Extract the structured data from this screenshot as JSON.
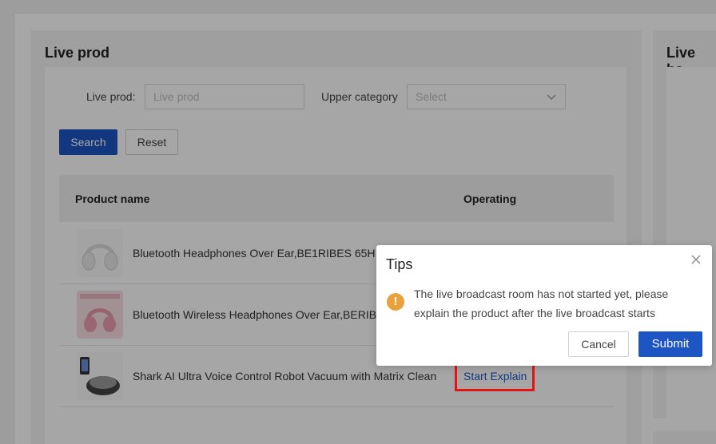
{
  "left_panel": {
    "title": "Live prod"
  },
  "right_panel": {
    "title": "Live ba"
  },
  "filters": {
    "live_prod_label": "Live prod:",
    "live_prod_placeholder": "Live prod",
    "upper_category_label": "Upper category",
    "upper_category_placeholder": "Select"
  },
  "buttons": {
    "search": "Search",
    "reset": "Reset"
  },
  "table": {
    "headers": {
      "product_name": "Product name",
      "operating": "Operating"
    },
    "rows": [
      {
        "name": "Bluetooth Headphones Over Ear,BE1RIBES 65H",
        "thumb_icon": "headphones-white-image",
        "action": ""
      },
      {
        "name": "Bluetooth Wireless Headphones Over Ear,BERIB",
        "thumb_icon": "headphones-pink-image",
        "action": ""
      },
      {
        "name": "Shark AI Ultra Voice Control Robot Vacuum with Matrix Clean",
        "thumb_icon": "robot-vacuum-image",
        "action": "Start Explain"
      }
    ]
  },
  "dialog": {
    "title": "Tips",
    "message": "The live broadcast room has not started yet, please explain the product after the live broadcast starts",
    "cancel": "Cancel",
    "submit": "Submit",
    "warning_symbol": "!"
  },
  "colors": {
    "primary": "#1e55c4",
    "warning": "#e9a23b",
    "highlight": "#e01616"
  }
}
